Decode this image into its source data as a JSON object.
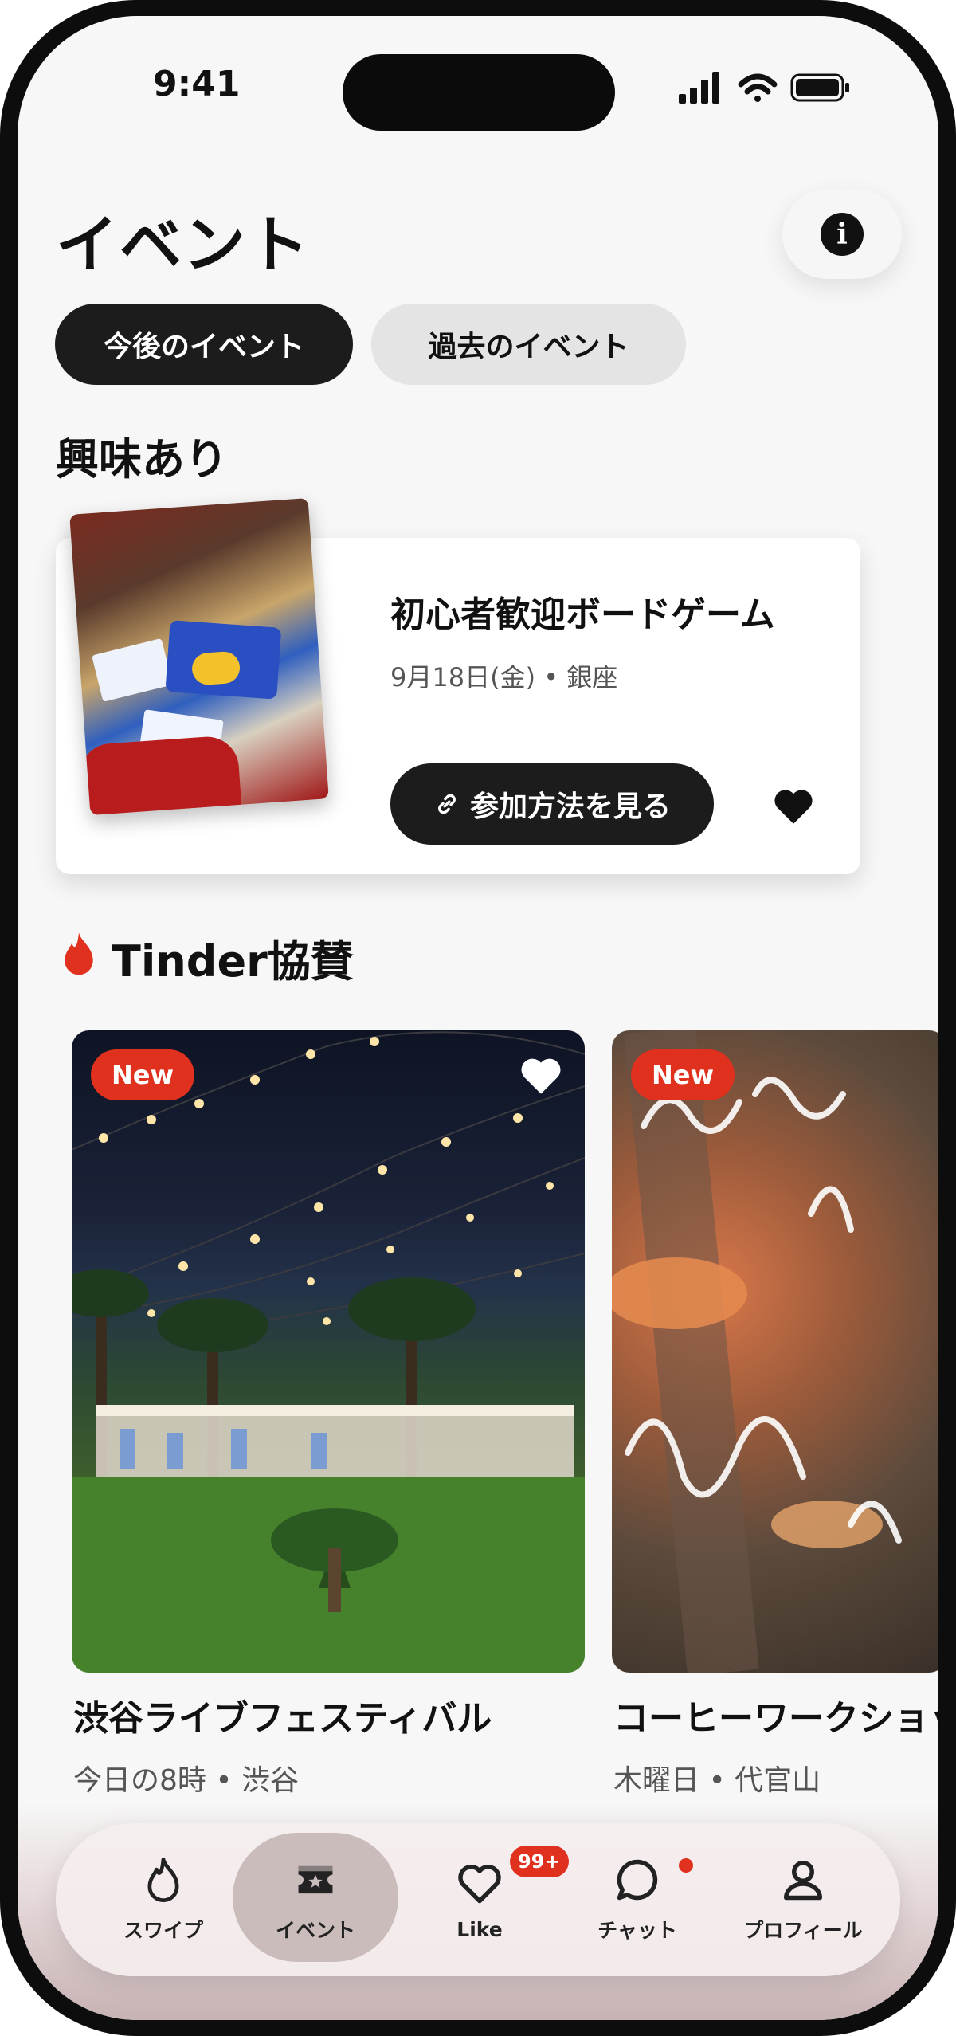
{
  "status_bar": {
    "time": "9:41"
  },
  "header": {
    "title": "イベント"
  },
  "segments": {
    "upcoming": "今後のイベント",
    "past": "過去のイベント"
  },
  "interested": {
    "section_title": "興味あり",
    "card": {
      "name": "初心者歓迎ボードゲーム",
      "meta": "9月18日(金) • 銀座",
      "join_label": "参加方法を見る"
    }
  },
  "sponsored": {
    "section_title": "Tinder協賛",
    "cards": [
      {
        "badge": "New",
        "title": "渋谷ライブフェスティバル",
        "meta": "今日の8時 • 渋谷"
      },
      {
        "badge": "New",
        "title": "コーヒーワークショップ",
        "meta": "木曜日 • 代官山"
      }
    ]
  },
  "tabbar": {
    "items": [
      {
        "label": "スワイプ",
        "icon": "flame-icon"
      },
      {
        "label": "イベント",
        "icon": "ticket-icon"
      },
      {
        "label": "Like",
        "icon": "heart-icon",
        "badge": "99+"
      },
      {
        "label": "チャット",
        "icon": "chat-icon"
      },
      {
        "label": "プロフィール",
        "icon": "person-icon"
      }
    ]
  },
  "colors": {
    "accent": "#E0301E",
    "dark": "#1C1C1C",
    "pill_inactive": "#E4E4E4"
  }
}
